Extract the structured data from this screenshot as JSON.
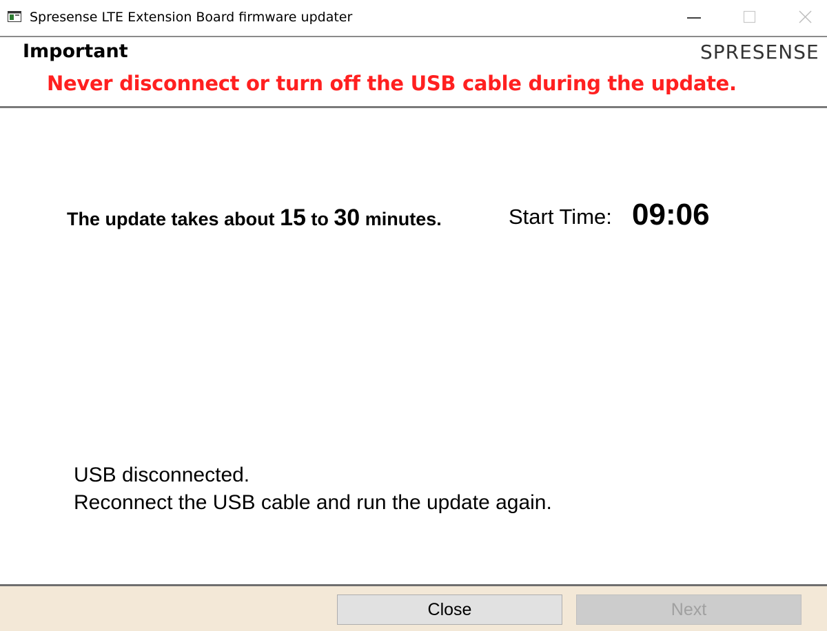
{
  "window": {
    "title": "Spresense LTE Extension Board firmware updater",
    "controls": {
      "minimize": "minimize-icon",
      "maximize": "maximize-icon",
      "close": "close-icon"
    }
  },
  "header": {
    "heading": "Important",
    "logo": "SPRESENSE",
    "warning": "Never disconnect or turn off the USB cable during the update.",
    "warning_color": "#ff2020"
  },
  "main": {
    "duration": {
      "prefix": "The update takes about ",
      "min": "15",
      "middle": " to ",
      "max": "30",
      "suffix": " minutes."
    },
    "start_time_label": "Start Time:",
    "start_time_value": "09:06",
    "status_line_1": "USB disconnected.",
    "status_line_2": "Reconnect the USB cable and run the update again."
  },
  "footer": {
    "close_label": "Close",
    "next_label": "Next",
    "next_enabled": false,
    "background": "#f3e8d7"
  }
}
